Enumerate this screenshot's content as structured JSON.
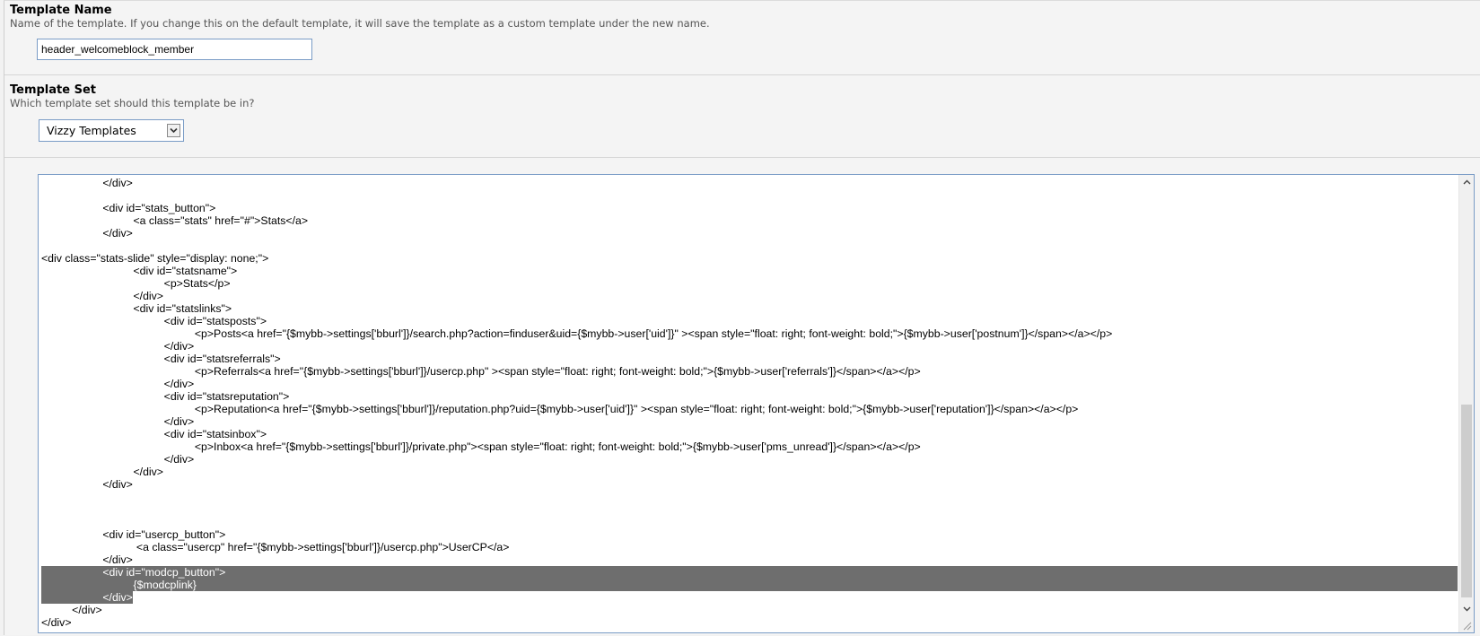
{
  "template_name": {
    "label": "Template Name",
    "description": "Name of the template. If you change this on the default template, it will save the template as a custom template under the new name.",
    "value": "header_welcomeblock_member"
  },
  "template_set": {
    "label": "Template Set",
    "description": "Which template set should this template be in?",
    "selected": "Vizzy Templates",
    "dropdown_icon": "chevron-down-icon"
  },
  "code_editor": {
    "lines": [
      "\t\t</div>",
      "",
      "\t\t<div id=\"stats_button\">",
      "\t\t\t<a class=\"stats\" href=\"#\">Stats</a>",
      "\t\t</div>",
      "",
      "<div class=\"stats-slide\" style=\"display: none;\">",
      "\t\t\t<div id=\"statsname\">",
      "\t\t\t\t<p>Stats</p>",
      "\t\t\t</div>",
      "\t\t\t<div id=\"statslinks\">",
      "\t\t\t\t<div id=\"statsposts\">",
      "\t\t\t\t\t<p>Posts<a href=\"{$mybb->settings['bburl']}/search.php?action=finduser&uid={$mybb->user['uid']}\" ><span style=\"float: right; font-weight: bold;\">{$mybb->user['postnum']}</span></a></p>",
      "\t\t\t\t</div>",
      "\t\t\t\t<div id=\"statsreferrals\">",
      "\t\t\t\t\t<p>Referrals<a href=\"{$mybb->settings['bburl']}/usercp.php\" ><span style=\"float: right; font-weight: bold;\">{$mybb->user['referrals']}</span></a></p>",
      "\t\t\t\t</div>",
      "\t\t\t\t<div id=\"statsreputation\">",
      "\t\t\t\t\t<p>Reputation<a href=\"{$mybb->settings['bburl']}/reputation.php?uid={$mybb->user['uid']}\" ><span style=\"float: right; font-weight: bold;\">{$mybb->user['reputation']}</span></a></p>",
      "\t\t\t\t</div>",
      "\t\t\t\t<div id=\"statsinbox\">",
      "\t\t\t\t\t<p>Inbox<a href=\"{$mybb->settings['bburl']}/private.php\"><span style=\"float: right; font-weight: bold;\">{$mybb->user['pms_unread']}</span></a></p>",
      "\t\t\t\t</div>",
      "\t\t\t</div>",
      "\t\t</div>",
      "",
      "",
      "",
      "\t\t<div id=\"usercp_button\">",
      "\t\t\t <a class=\"usercp\" href=\"{$mybb->settings['bburl']}/usercp.php\">UserCP</a>",
      "\t\t</div>",
      "\t\t<div id=\"modcp_button\">",
      "\t\t\t{$modcplink}",
      "\t\t</div>",
      "\t</div>",
      "</div>"
    ],
    "selected_lines": [
      31,
      32,
      33
    ]
  }
}
